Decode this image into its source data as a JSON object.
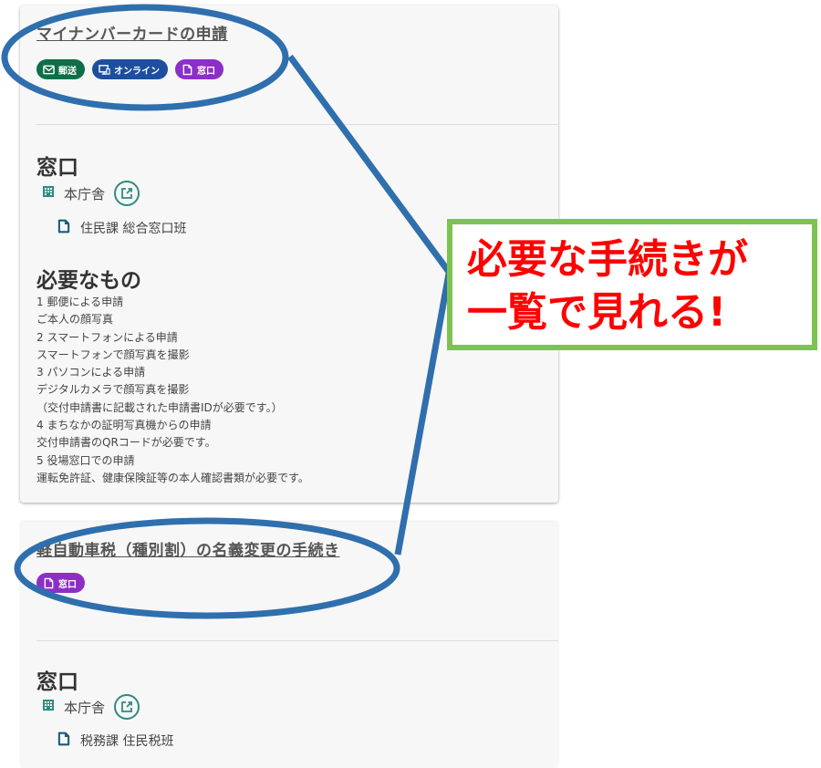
{
  "procedures": [
    {
      "title": "マイナンバーカードの申請",
      "chips": [
        {
          "label": "郵送",
          "color": "#0f6e47",
          "icon": "mail-icon"
        },
        {
          "label": "オンライン",
          "color": "#1d4f9e",
          "icon": "monitor-icon"
        },
        {
          "label": "窓口",
          "color": "#8c2fc7",
          "icon": "document-icon"
        }
      ],
      "window_title": "窓口",
      "building": "本庁舎",
      "department": "住民課 総合窓口班",
      "requirements_title": "必要なもの",
      "requirements": [
        "1 郵便による申請",
        "ご本人の顔写真",
        "2 スマートフォンによる申請",
        "スマートフォンで顔写真を撮影",
        "3 パソコンによる申請",
        "デジタルカメラで顔写真を撮影",
        "（交付申請書に記載された申請書IDが必要です。）",
        "4 まちなかの証明写真機からの申請",
        "交付申請書のQRコードが必要です。",
        "5 役場窓口での申請",
        "運転免許証、健康保険証等の本人確認書類が必要です。"
      ]
    },
    {
      "title": "軽自動車税（種別割）の名義変更の手続き",
      "chips": [
        {
          "label": "窓口",
          "color": "#8c2fc7",
          "icon": "document-icon"
        }
      ],
      "window_title": "窓口",
      "building": "本庁舎",
      "department": "税務課 住民税班"
    }
  ],
  "callout": {
    "line1": "必要な手続きが",
    "line2": "一覧で見れる!"
  },
  "colors": {
    "annotation_blue": "#2f6fad",
    "callout_border": "#7cc44f",
    "callout_text": "#ff0000",
    "teal_icon": "#2e8b82"
  }
}
